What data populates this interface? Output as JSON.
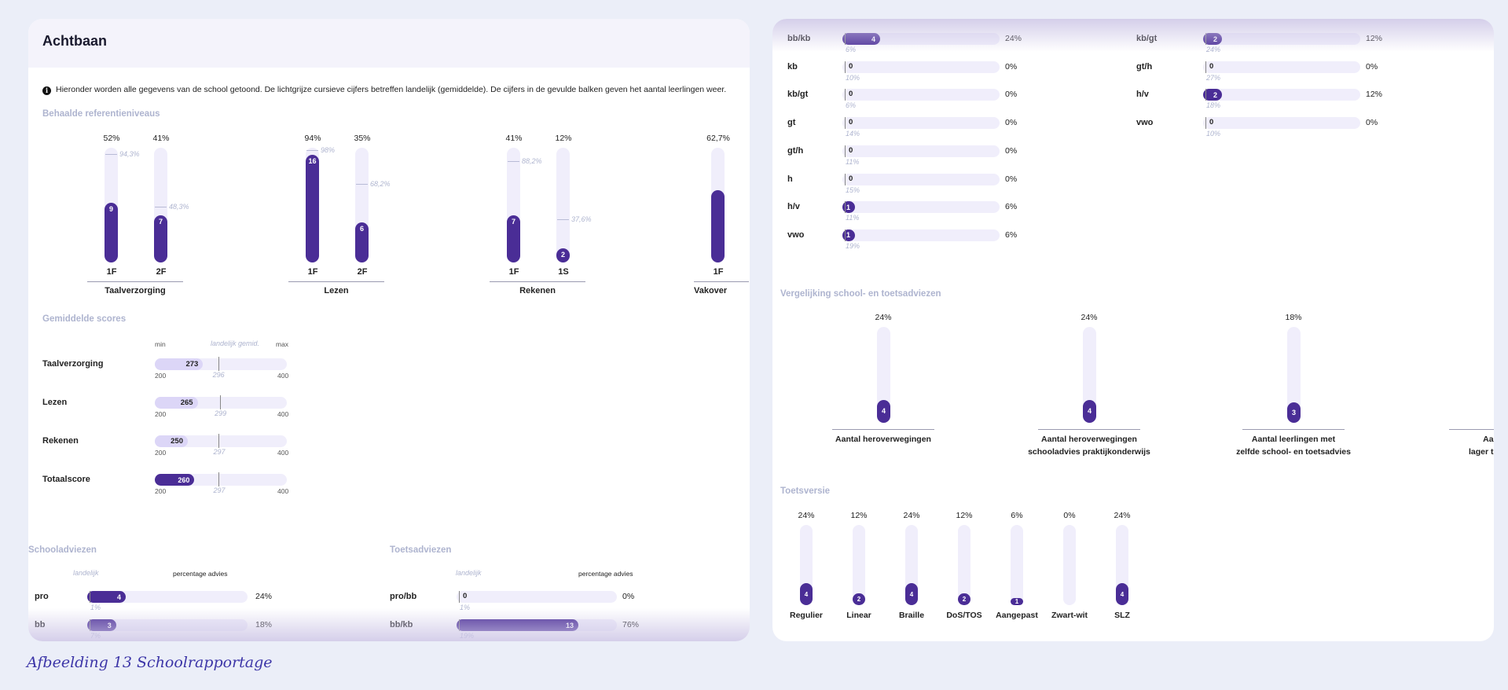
{
  "left": {
    "title": "Achtbaan",
    "info_text": "Hieronder worden alle gegevens van de school getoond. De lichtgrijze cursieve cijfers betreffen landelijk (gemiddelde). De cijfers in de gevulde balken geven het aantal leerlingen weer.",
    "ref_section": "Behaalde referentieniveaus",
    "ref_groups": [
      {
        "name": "Taalverzorging",
        "bars": [
          {
            "level": "1F",
            "pct": "52%",
            "count": "9",
            "national": "94,3%"
          },
          {
            "level": "2F",
            "pct": "41%",
            "count": "7",
            "national": "48,3%"
          }
        ]
      },
      {
        "name": "Lezen",
        "bars": [
          {
            "level": "1F",
            "pct": "94%",
            "count": "16",
            "national": "98%"
          },
          {
            "level": "2F",
            "pct": "35%",
            "count": "6",
            "national": "68,2%"
          }
        ]
      },
      {
        "name": "Rekenen",
        "bars": [
          {
            "level": "1F",
            "pct": "41%",
            "count": "7",
            "national": "88,2%"
          },
          {
            "level": "1S",
            "pct": "12%",
            "count": "2",
            "national": "37,6%"
          }
        ]
      },
      {
        "name": "Vakover",
        "bars": [
          {
            "level": "1F",
            "pct": "62,7%",
            "count": "",
            "national": ""
          }
        ]
      }
    ],
    "scores_section": "Gemiddelde scores",
    "scores_header": {
      "min": "min",
      "national": "landelijk gemid.",
      "max": "max"
    },
    "scores": [
      {
        "name": "Taalverzorging",
        "value": "273",
        "national": "296",
        "min": "200",
        "max": "400"
      },
      {
        "name": "Lezen",
        "value": "265",
        "national": "299",
        "min": "200",
        "max": "400"
      },
      {
        "name": "Rekenen",
        "value": "250",
        "national": "297",
        "min": "200",
        "max": "400"
      },
      {
        "name": "Totaalscore",
        "value": "260",
        "national": "297",
        "min": "200",
        "max": "400"
      }
    ],
    "school_advice": {
      "title": "Schooladviezen",
      "col_national": "landelijk",
      "col_pct": "percentage advies",
      "rows": [
        {
          "label": "pro",
          "count": "4",
          "pct": "24%",
          "national": "1%"
        },
        {
          "label": "bb",
          "count": "3",
          "pct": "18%",
          "national": "7%"
        }
      ]
    },
    "test_advice": {
      "title": "Toetsadviezen",
      "col_national": "landelijk",
      "col_pct": "percentage advies",
      "rows": [
        {
          "label": "pro/bb",
          "count": "0",
          "pct": "0%",
          "national": "1%"
        },
        {
          "label": "bb/kb",
          "count": "13",
          "pct": "76%",
          "national": "19%"
        }
      ]
    }
  },
  "right": {
    "advice_col1": [
      {
        "label": "bb/kb",
        "count": "4",
        "pct": "24%",
        "national": "6%"
      },
      {
        "label": "kb",
        "count": "0",
        "pct": "0%",
        "national": "10%"
      },
      {
        "label": "kb/gt",
        "count": "0",
        "pct": "0%",
        "national": "6%"
      },
      {
        "label": "gt",
        "count": "0",
        "pct": "0%",
        "national": "14%"
      },
      {
        "label": "gt/h",
        "count": "0",
        "pct": "0%",
        "national": "11%"
      },
      {
        "label": "h",
        "count": "0",
        "pct": "0%",
        "national": "15%"
      },
      {
        "label": "h/v",
        "count": "1",
        "pct": "6%",
        "national": "11%"
      },
      {
        "label": "vwo",
        "count": "1",
        "pct": "6%",
        "national": "19%"
      }
    ],
    "advice_col2": [
      {
        "label": "kb/gt",
        "count": "2",
        "pct": "12%",
        "national": "24%"
      },
      {
        "label": "gt/h",
        "count": "0",
        "pct": "0%",
        "national": "27%"
      },
      {
        "label": "h/v",
        "count": "2",
        "pct": "12%",
        "national": "18%"
      },
      {
        "label": "vwo",
        "count": "0",
        "pct": "0%",
        "national": "10%"
      }
    ],
    "compare_section": "Vergelijking school- en toetsadviezen",
    "compare": [
      {
        "pct": "24%",
        "count": "4",
        "label1": "Aantal heroverwegingen",
        "label2": ""
      },
      {
        "pct": "24%",
        "count": "4",
        "label1": "Aantal heroverwegingen",
        "label2": "schooladvies praktijkonderwijs"
      },
      {
        "pct": "18%",
        "count": "3",
        "label1": "Aantal leerlingen met",
        "label2": "zelfde school- en toetsadvies"
      },
      {
        "pct": "",
        "count": "",
        "label1": "Aantal le",
        "label2": "lager toetsadvie"
      }
    ],
    "version_section": "Toetsversie",
    "versions": [
      {
        "pct": "24%",
        "count": "4",
        "label": "Regulier"
      },
      {
        "pct": "12%",
        "count": "2",
        "label": "Linear"
      },
      {
        "pct": "24%",
        "count": "4",
        "label": "Braille"
      },
      {
        "pct": "12%",
        "count": "2",
        "label": "DoS/TOS"
      },
      {
        "pct": "6%",
        "count": "1",
        "label": "Aangepast"
      },
      {
        "pct": "0%",
        "count": "",
        "label": "Zwart-wit"
      },
      {
        "pct": "24%",
        "count": "4",
        "label": "SLZ"
      }
    ]
  },
  "caption": "Afbeelding 13 Schoolrapportage",
  "colors": {
    "accent": "#4a2d96",
    "track": "#f0eefb",
    "muted": "#aeb4cf",
    "light_fill": "#dcd6f7"
  }
}
